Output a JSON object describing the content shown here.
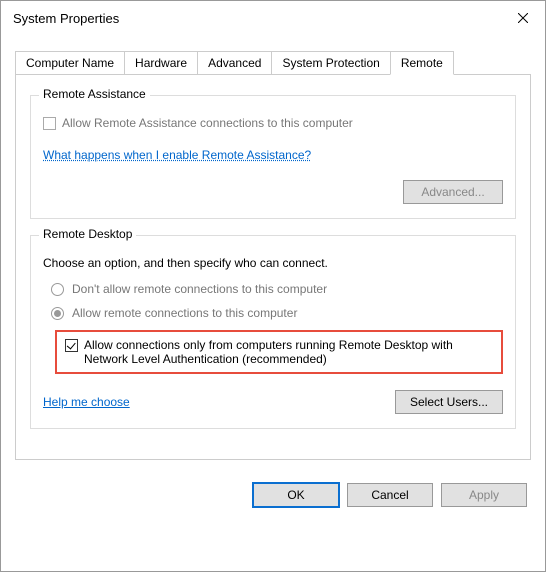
{
  "window": {
    "title": "System Properties"
  },
  "tabs": {
    "computerName": "Computer Name",
    "hardware": "Hardware",
    "advanced": "Advanced",
    "systemProtection": "System Protection",
    "remote": "Remote"
  },
  "remoteAssistance": {
    "legend": "Remote Assistance",
    "allowLabel": "Allow Remote Assistance connections to this computer",
    "link": "What happens when I enable Remote Assistance?",
    "advancedBtn": "Advanced..."
  },
  "remoteDesktop": {
    "legend": "Remote Desktop",
    "intro": "Choose an option, and then specify who can connect.",
    "optDisallow": "Don't allow remote connections to this computer",
    "optAllow": "Allow remote connections to this computer",
    "nla": "Allow connections only from computers running Remote Desktop with Network Level Authentication (recommended)",
    "helpLink": "Help me choose",
    "selectUsersBtn": "Select Users..."
  },
  "buttons": {
    "ok": "OK",
    "cancel": "Cancel",
    "apply": "Apply"
  }
}
